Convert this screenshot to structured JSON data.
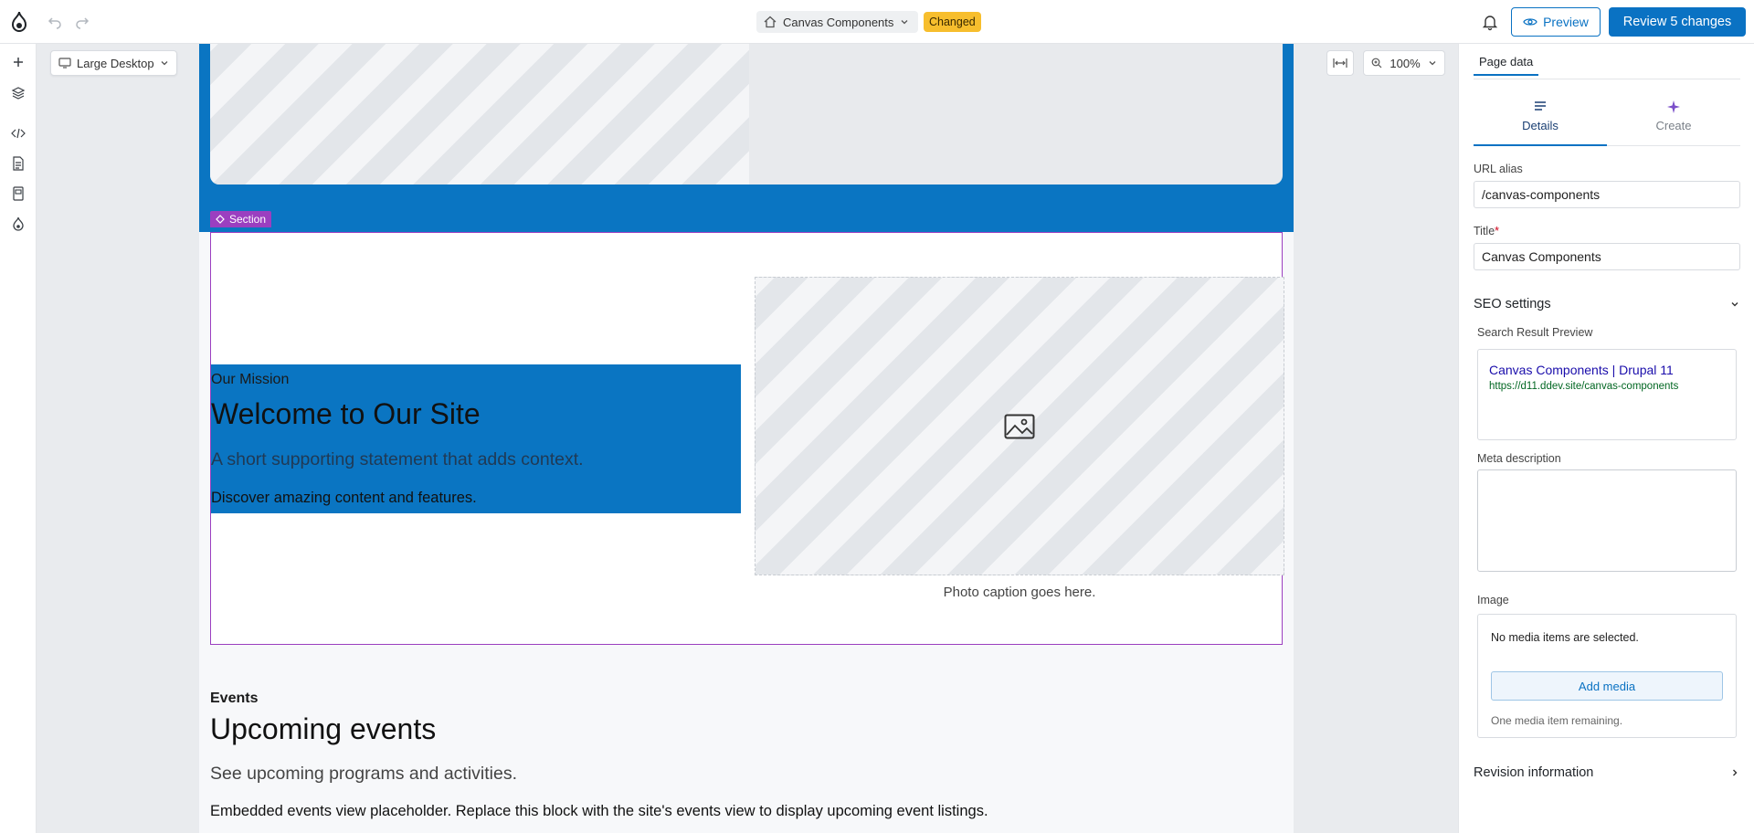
{
  "topbar": {
    "page_title": "Canvas Components",
    "status_badge": "Changed",
    "preview_label": "Preview",
    "review_label": "Review 5 changes"
  },
  "canvas": {
    "device": "Large Desktop",
    "zoom": "100%"
  },
  "section": {
    "label": "Section",
    "mission": {
      "eyebrow": "Our Mission",
      "title": "Welcome to Our Site",
      "subtitle": "A short supporting statement that adds context.",
      "body": "Discover amazing content and features."
    },
    "image_caption": "Photo caption goes here."
  },
  "events": {
    "eyebrow": "Events",
    "title": "Upcoming events",
    "subtitle": "See upcoming programs and activities.",
    "body": "Embedded events view placeholder. Replace this block with the site's events view to display upcoming event listings."
  },
  "panel": {
    "top_tab": "Page data",
    "subtabs": [
      {
        "label": "Details",
        "icon": "details-icon",
        "active": true
      },
      {
        "label": "Create",
        "icon": "sparkle-icon",
        "active": false
      }
    ],
    "url_alias_label": "URL alias",
    "url_alias_value": "/canvas-components",
    "title_label": "Title",
    "title_required": "*",
    "title_value": "Canvas Components",
    "seo_heading": "SEO settings",
    "search_preview_label": "Search Result Preview",
    "serp_title": "Canvas Components | Drupal 11",
    "serp_url": "https://d11.ddev.site/canvas-components",
    "meta_description_label": "Meta description",
    "image_label": "Image",
    "no_media": "No media items are selected.",
    "add_media": "Add media",
    "media_remaining": "One media item remaining.",
    "revision_heading": "Revision information"
  },
  "colors": {
    "accent": "#0a72c3",
    "section_outline": "#9b3fc0",
    "badge": "#f7be2d",
    "hero_blue": "#0a75c2"
  }
}
